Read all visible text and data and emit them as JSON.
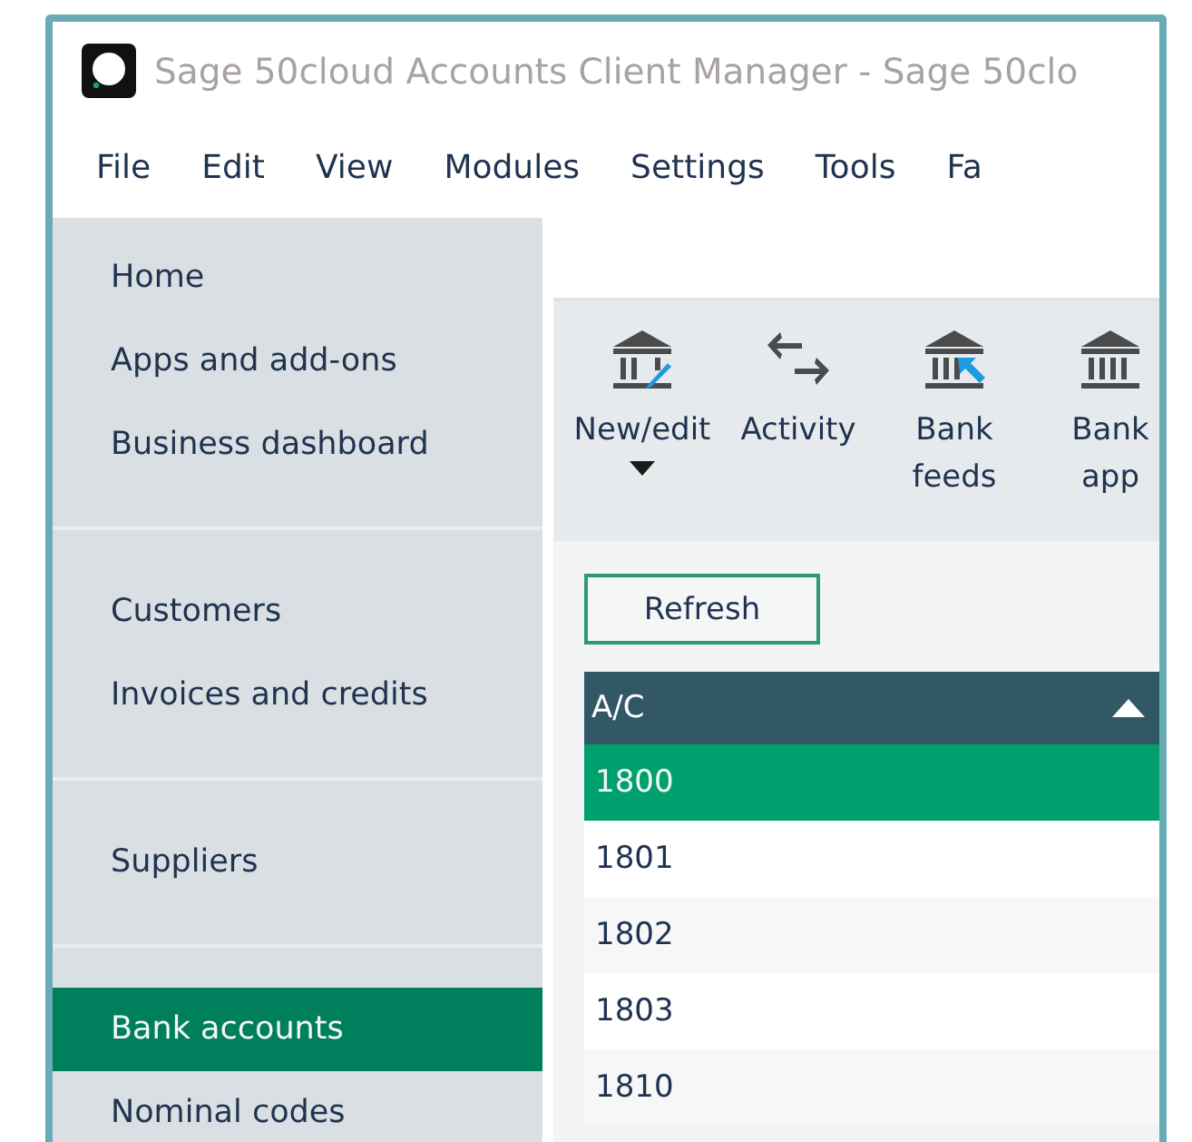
{
  "window": {
    "title": "Sage 50cloud Accounts Client Manager - Sage 50clo"
  },
  "menu": [
    {
      "label": "File"
    },
    {
      "label": "Edit"
    },
    {
      "label": "View"
    },
    {
      "label": "Modules"
    },
    {
      "label": "Settings"
    },
    {
      "label": "Tools"
    },
    {
      "label": "Fa"
    }
  ],
  "sidebar": {
    "groups": [
      {
        "items": [
          {
            "label": "Home",
            "selected": false
          },
          {
            "label": "Apps and add-ons",
            "selected": false
          },
          {
            "label": "Business dashboard",
            "selected": false
          }
        ]
      },
      {
        "items": [
          {
            "label": "Customers",
            "selected": false
          },
          {
            "label": "Invoices and credits",
            "selected": false
          }
        ]
      },
      {
        "items": [
          {
            "label": "Suppliers",
            "selected": false
          }
        ]
      },
      {
        "items": [
          {
            "label": "Bank accounts",
            "selected": true
          },
          {
            "label": "Nominal codes",
            "selected": false
          }
        ]
      }
    ]
  },
  "toolbar": [
    {
      "lines": [
        "New/edit"
      ],
      "kind": "bank-edit",
      "dropdown": true
    },
    {
      "lines": [
        "Activity"
      ],
      "kind": "arrows",
      "dropdown": false
    },
    {
      "lines": [
        "Bank",
        "feeds"
      ],
      "kind": "bank-feed",
      "dropdown": false
    },
    {
      "lines": [
        "Bank",
        "app"
      ],
      "kind": "bank",
      "dropdown": false
    }
  ],
  "refresh_button": {
    "label": "Refresh"
  },
  "table": {
    "columns": [
      {
        "label": "A/C",
        "sorted": true
      }
    ],
    "rows": [
      {
        "cells": [
          "1800"
        ],
        "selected": true
      },
      {
        "cells": [
          "1801"
        ],
        "selected": false
      },
      {
        "cells": [
          "1802"
        ],
        "selected": false
      },
      {
        "cells": [
          "1803"
        ],
        "selected": false
      },
      {
        "cells": [
          "1810"
        ],
        "selected": false
      }
    ]
  }
}
